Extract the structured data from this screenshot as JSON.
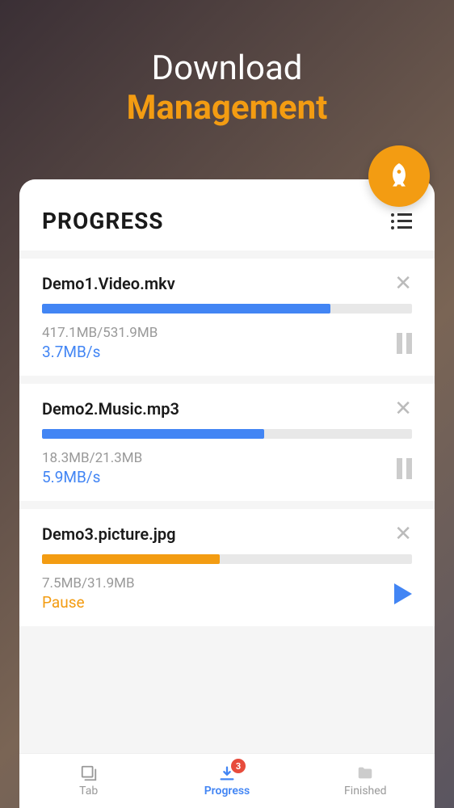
{
  "header": {
    "line1": "Download",
    "line2": "Management"
  },
  "card": {
    "title": "PROGRESS"
  },
  "downloads": [
    {
      "name": "Demo1.Video.mkv",
      "size": "417.1MB/531.9MB",
      "speed": "3.7MB/s",
      "progress": 78,
      "state": "downloading",
      "color": "blue"
    },
    {
      "name": "Demo2.Music.mp3",
      "size": "18.3MB/21.3MB",
      "speed": "5.9MB/s",
      "progress": 60,
      "state": "downloading",
      "color": "blue"
    },
    {
      "name": "Demo3.picture.jpg",
      "size": "7.5MB/31.9MB",
      "status": "Pause",
      "progress": 48,
      "state": "paused",
      "color": "orange"
    }
  ],
  "nav": {
    "tab": "Tab",
    "progress": "Progress",
    "finished": "Finished",
    "badge": "3"
  }
}
